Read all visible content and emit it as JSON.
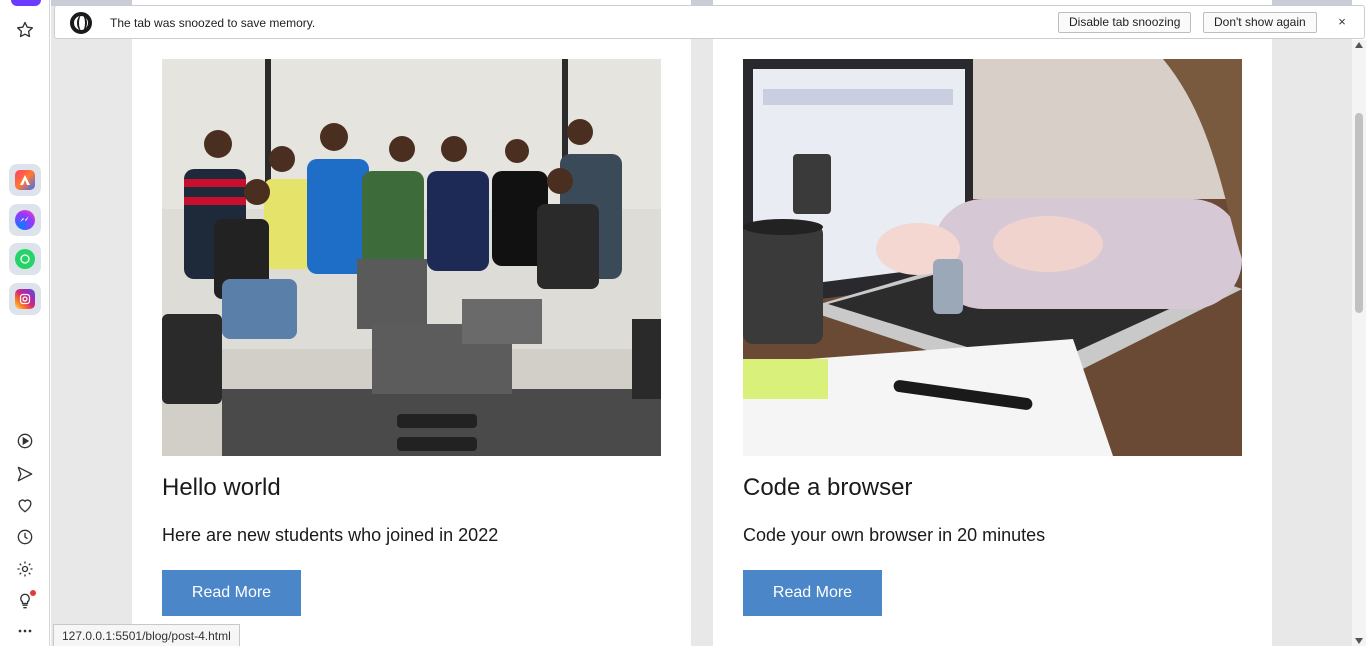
{
  "snooze_bar": {
    "message": "The tab was snoozed to save memory.",
    "disable_label": "Disable tab snoozing",
    "dont_show_label": "Don't show again",
    "close_glyph": "×"
  },
  "sidebar": {
    "top_items": [
      {
        "icon": "star-icon"
      }
    ],
    "apps": [
      {
        "icon": "aria-icon",
        "color": "#ff5a36"
      },
      {
        "icon": "messenger-icon",
        "color": "#2f7bf6"
      },
      {
        "icon": "whatsapp-icon",
        "color": "#25d366"
      },
      {
        "icon": "instagram-icon",
        "color": "#e1306c"
      }
    ],
    "bottom_items": [
      {
        "icon": "player-icon"
      },
      {
        "icon": "send-icon"
      },
      {
        "icon": "heart-icon"
      },
      {
        "icon": "history-icon"
      },
      {
        "icon": "settings-icon"
      },
      {
        "icon": "lightbulb-icon"
      },
      {
        "icon": "more-icon"
      }
    ]
  },
  "posts": [
    {
      "title": "Hello world",
      "description": "Here are new students who joined in 2022",
      "button": "Read More"
    },
    {
      "title": "Code a browser",
      "description": "Code your own browser in 20 minutes",
      "button": "Read More"
    }
  ],
  "status_url": "127.0.0.1:5501/blog/post-4.html",
  "colors": {
    "accent_button": "#4a86c8",
    "page_bg": "#e8e8e8",
    "card_bg": "#ffffff"
  }
}
